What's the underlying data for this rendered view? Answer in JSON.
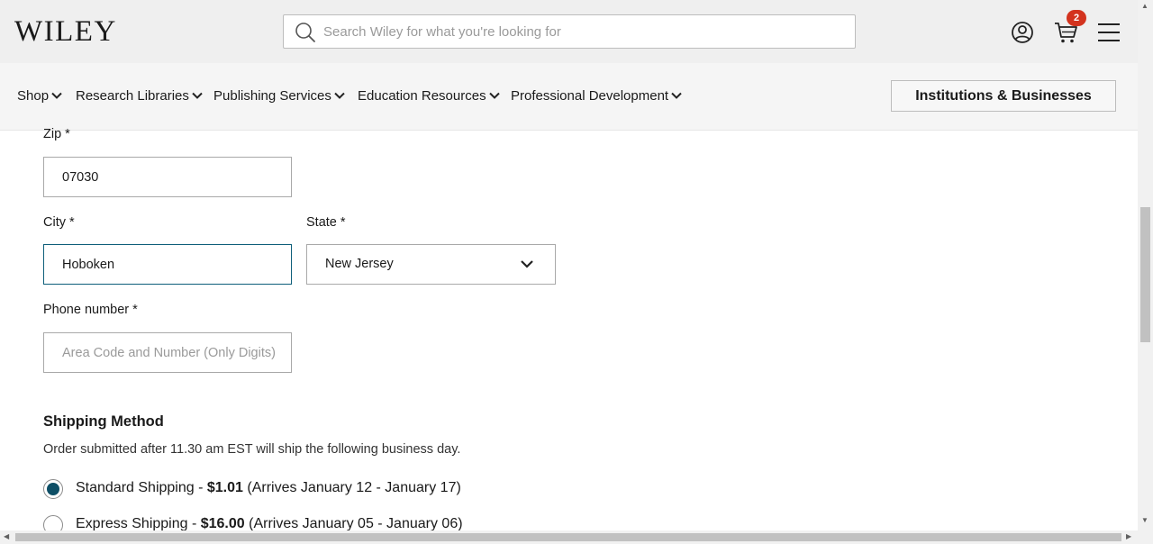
{
  "header": {
    "logo_text": "WILEY",
    "search_placeholder": "Search Wiley for what you're looking for",
    "cart_count": "2",
    "icons": [
      "search-icon",
      "account-icon",
      "cart-icon",
      "hamburger-menu-icon"
    ]
  },
  "nav": {
    "items": [
      {
        "label": "Shop"
      },
      {
        "label": "Research Libraries"
      },
      {
        "label": "Publishing Services"
      },
      {
        "label": "Education Resources"
      },
      {
        "label": "Professional Development"
      }
    ],
    "institutions_button": "Institutions & Businesses"
  },
  "form": {
    "zip": {
      "label": "Zip *",
      "value": "07030"
    },
    "city": {
      "label": "City *",
      "value": "Hoboken"
    },
    "state": {
      "label": "State *",
      "value": "New Jersey"
    },
    "phone": {
      "label": "Phone number *",
      "placeholder": "Area Code and Number (Only Digits)"
    }
  },
  "shipping": {
    "title": "Shipping Method",
    "note": "Order submitted after 11.30 am EST will ship the following business day.",
    "options": [
      {
        "name": "Standard Shipping - ",
        "price": "$1.01",
        "arrival": " (Arrives January 12 - January 17)",
        "selected": true
      },
      {
        "name": "Express Shipping - ",
        "price": "$16.00",
        "arrival": " (Arrives January 05 - January 06)",
        "selected": false
      }
    ]
  },
  "colors": {
    "accent": "#0e4f66",
    "badge": "#d3331e"
  }
}
